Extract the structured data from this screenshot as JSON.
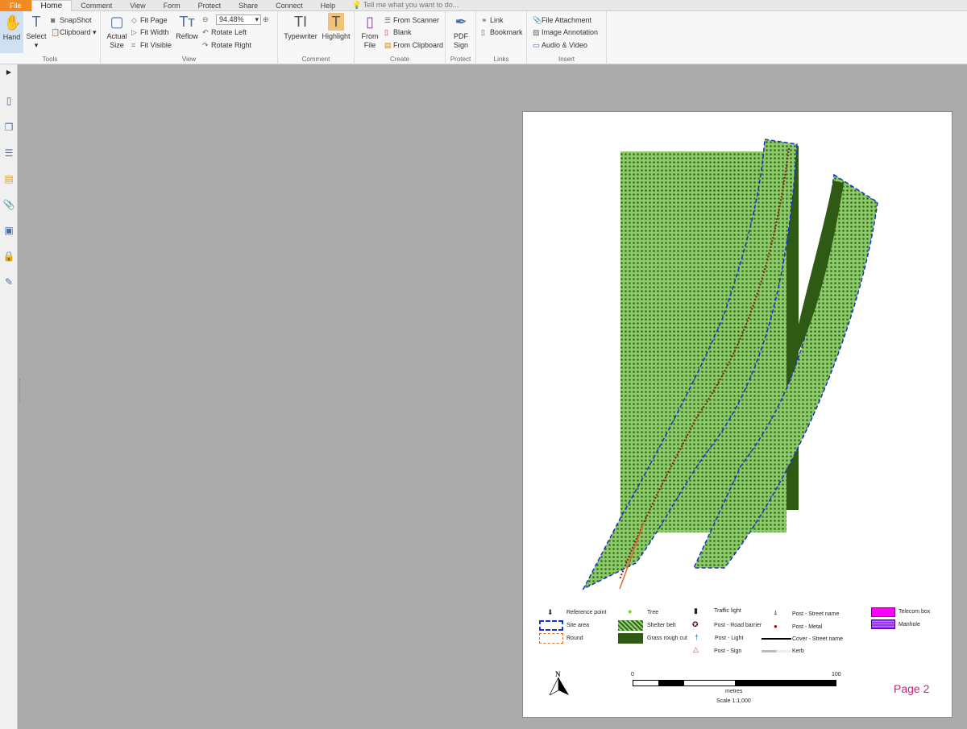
{
  "tabs": [
    "File",
    "Home",
    "Comment",
    "View",
    "Form",
    "Protect",
    "Share",
    "Connect",
    "Help"
  ],
  "tell_me": "Tell me what you want to do...",
  "ribbon": {
    "tools": {
      "label": "Tools",
      "hand": "Hand",
      "select": "Select",
      "snapshot": "SnapShot",
      "clipboard": "Clipboard"
    },
    "view": {
      "label": "View",
      "actual_size": "Actual Size",
      "fit_page": "Fit Page",
      "fit_width": "Fit Width",
      "fit_visible": "Fit Visible",
      "reflow": "Reflow",
      "zoom": "94.48%",
      "rotate_left": "Rotate Left",
      "rotate_right": "Rotate Right"
    },
    "comment": {
      "label": "Comment",
      "typewriter": "Typewriter",
      "highlight": "Highlight"
    },
    "create": {
      "label": "Create",
      "from_file": "From File",
      "from_scanner": "From Scanner",
      "blank": "Blank",
      "from_clipboard": "From Clipboard"
    },
    "protect": {
      "label": "Protect",
      "pdf_sign": "PDF Sign"
    },
    "links": {
      "label": "Links",
      "link": "Link",
      "bookmark": "Bookmark"
    },
    "insert": {
      "label": "Insert",
      "file_attachment": "File Attachment",
      "image_annotation": "Image Annotation",
      "audio_video": "Audio & Video"
    }
  },
  "legend": {
    "reference_point": "Reference point",
    "site_area": "Site area",
    "round": "Round",
    "tree": "Tree",
    "shelter_belt": "Shelter belt",
    "grass_rough_cut": "Grass rough cut",
    "traffic_light": "Traffic light",
    "post_road_barrier": "Post - Road barrier",
    "post_light": "Post - Light",
    "post_sign": "Post - Sign",
    "post_street_name": "Post - Street name",
    "post_metal": "Post - Metal",
    "cover_street_name": "Cover - Street name",
    "kerb": "Kerb",
    "telecom_box": "Telecom box",
    "manhole": "Manhole"
  },
  "scale": {
    "start": "0",
    "end": "100",
    "unit": "metres",
    "text": "Scale 1:1,000"
  },
  "north": "N",
  "page_label": "Page 2",
  "colors": {
    "file_tab": "#f08a24",
    "shelter": "#7fbf5a",
    "grass": "#2f5a14",
    "site": "#1a2fd6",
    "page_label": "#d0207a",
    "telecom": "#ff00ff",
    "manhole": "#9933ff"
  }
}
